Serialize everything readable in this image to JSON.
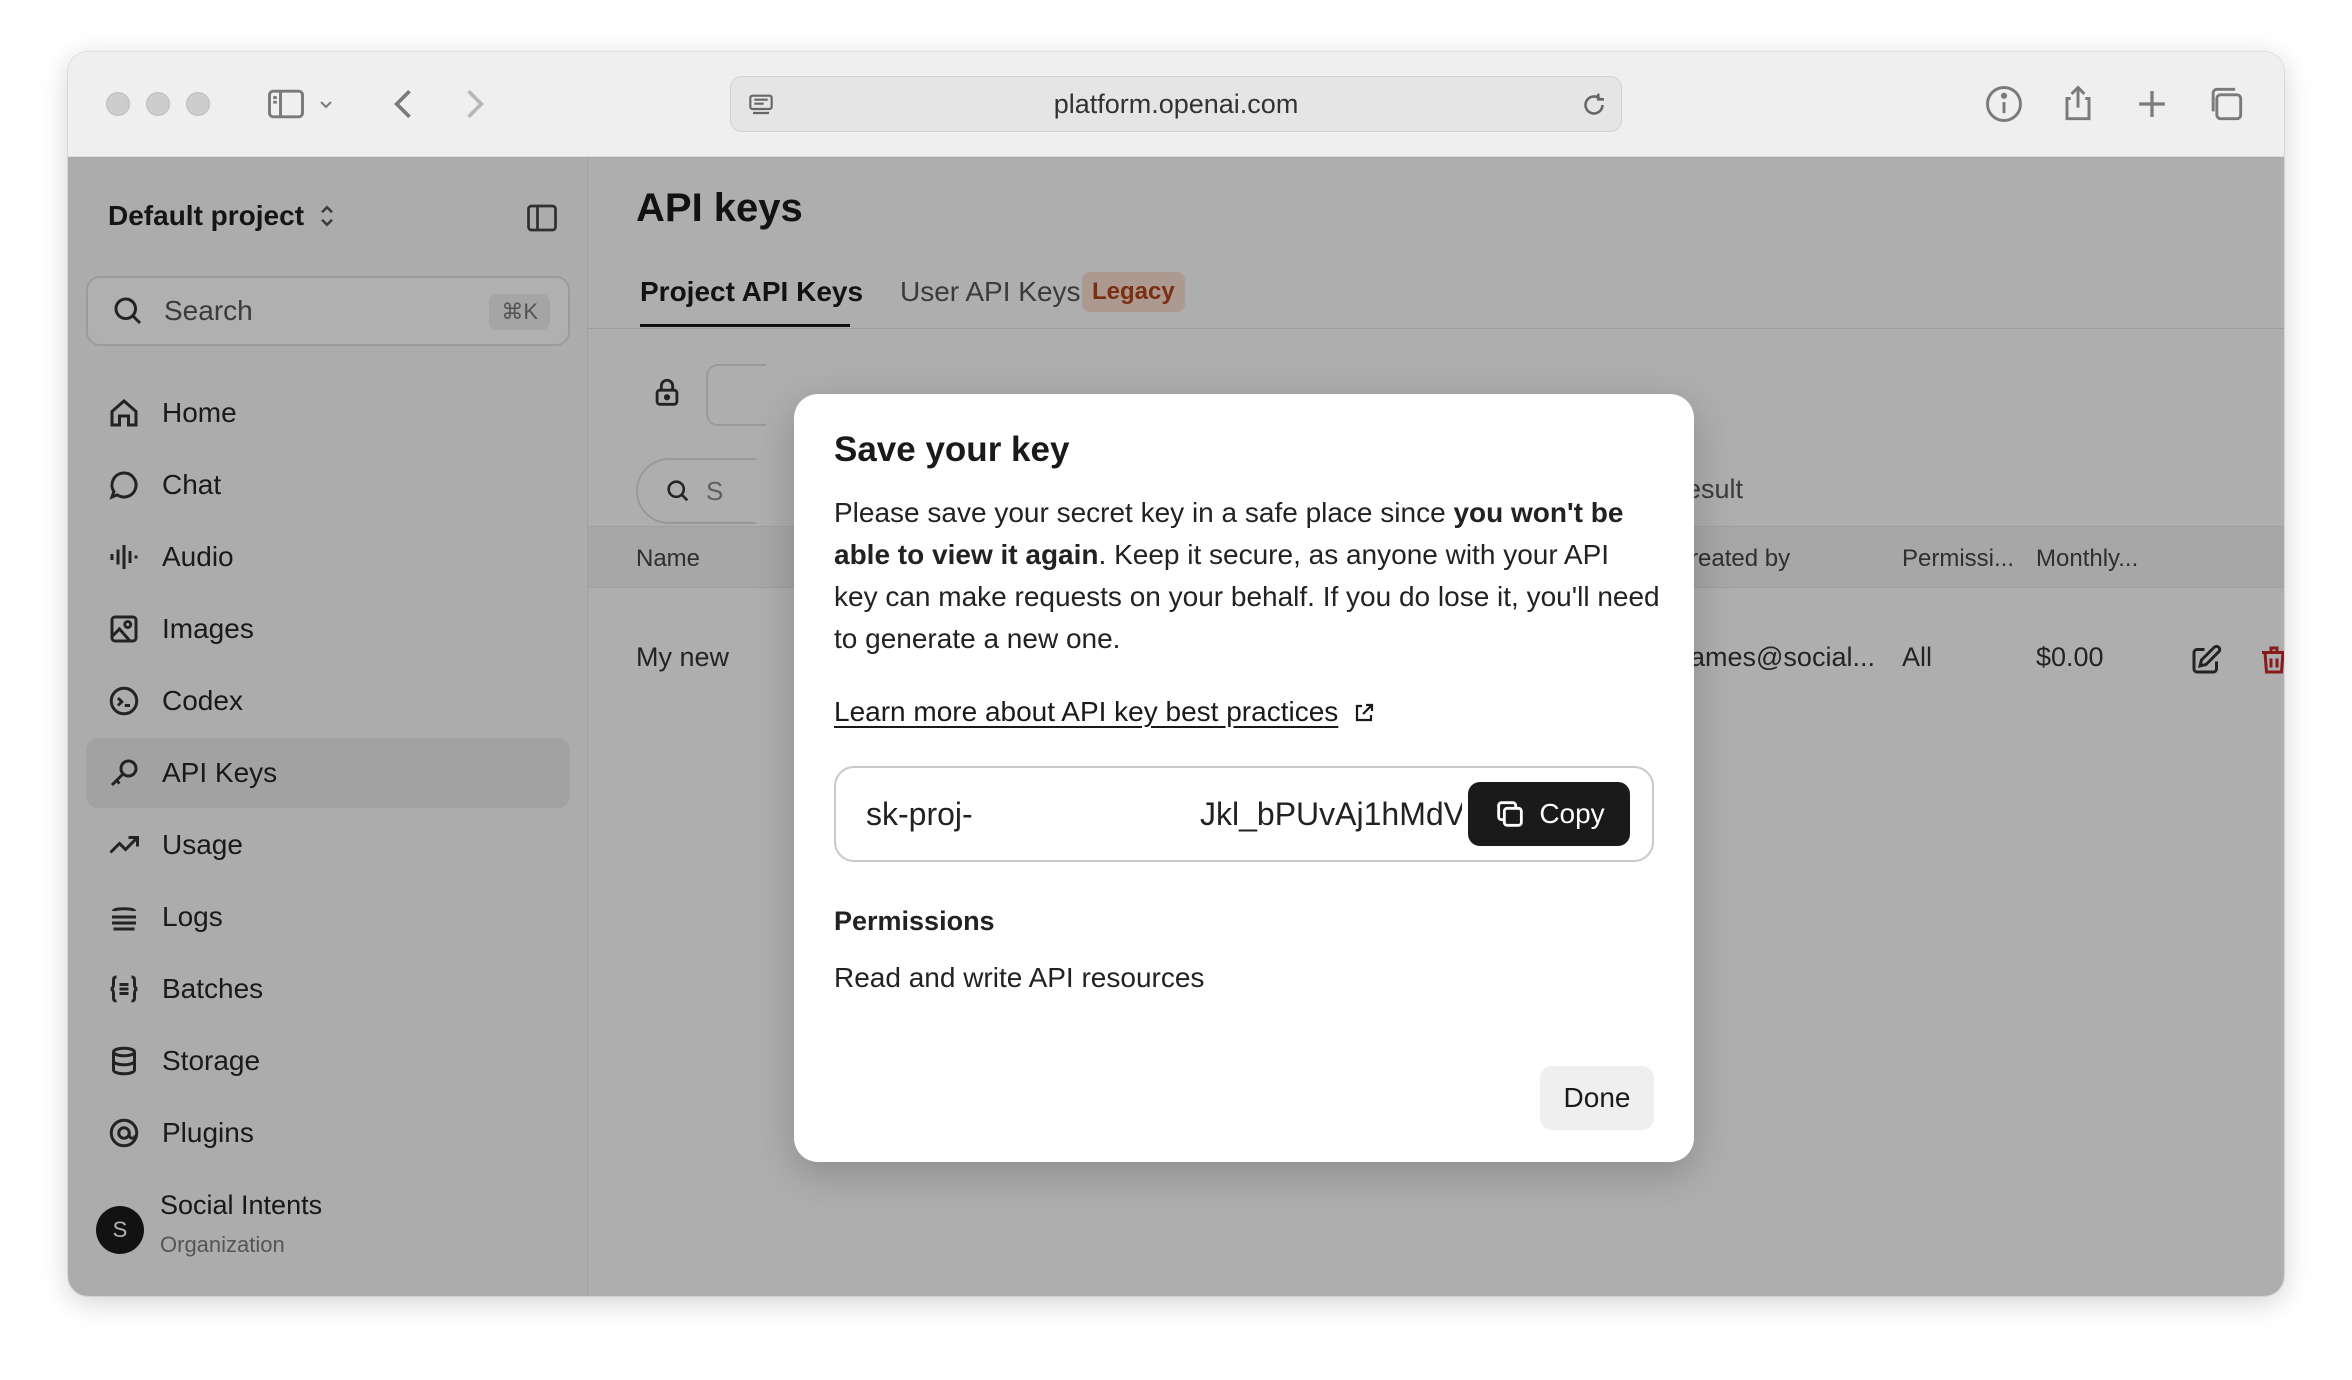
{
  "browser": {
    "url": "platform.openai.com"
  },
  "sidebar": {
    "project": "Default project",
    "search": {
      "label": "Search",
      "shortcut": "⌘K"
    },
    "items": [
      {
        "label": "Home",
        "icon": "home-icon"
      },
      {
        "label": "Chat",
        "icon": "chat-icon"
      },
      {
        "label": "Audio",
        "icon": "audio-icon"
      },
      {
        "label": "Images",
        "icon": "images-icon"
      },
      {
        "label": "Codex",
        "icon": "codex-icon"
      },
      {
        "label": "API Keys",
        "icon": "key-icon",
        "active": true
      },
      {
        "label": "Usage",
        "icon": "usage-icon"
      },
      {
        "label": "Logs",
        "icon": "logs-icon"
      },
      {
        "label": "Batches",
        "icon": "batches-icon"
      },
      {
        "label": "Storage",
        "icon": "storage-icon"
      },
      {
        "label": "Plugins",
        "icon": "plugins-icon"
      }
    ],
    "org": {
      "initial": "S",
      "name": "Social Intents",
      "role": "Organization"
    }
  },
  "main": {
    "title": "API keys",
    "tabs": [
      {
        "label": "Project API Keys",
        "active": true
      },
      {
        "label": "User API Keys"
      }
    ],
    "legacy_badge": "Legacy",
    "search_partial": "S",
    "results_partial": "esult",
    "table": {
      "headers": [
        "Name",
        "reated by",
        "Permissi...",
        "Monthly..."
      ],
      "row": {
        "name": "My new",
        "created_by": "ames@social...",
        "permissions": "All",
        "monthly": "$0.00"
      }
    }
  },
  "modal": {
    "title": "Save your key",
    "body_1": "Please save your secret key in a safe place since ",
    "body_bold": "you won't be able to view it again",
    "body_2": ". Keep it secure, as anyone with your API key can make requests on your behalf. If you do lose it, you'll need to generate a new one.",
    "learn_link": "Learn more about API key best practices",
    "key_prefix": "sk-proj-",
    "key_visible": "Jkl_bPUvAj1hMdV",
    "copy_label": "Copy",
    "permissions_title": "Permissions",
    "permissions_value": "Read and write API resources",
    "done_label": "Done"
  },
  "colors": {
    "legacy_badge_bg": "#f7dbcf",
    "legacy_badge_text": "#b0421a",
    "delete_icon": "#c22626",
    "copy_button_bg": "#1a1a1a"
  }
}
